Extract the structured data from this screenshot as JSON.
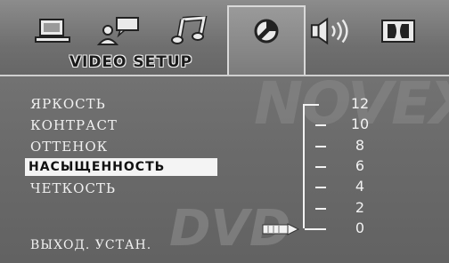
{
  "window_title": "VIDEO SETUP",
  "tabs": [
    {
      "icon": "monitor-icon"
    },
    {
      "icon": "user-speech-icon"
    },
    {
      "icon": "music-note-icon"
    },
    {
      "icon": "video-circle-icon",
      "active": true
    },
    {
      "icon": "speaker-icon"
    },
    {
      "icon": "dolby-icon"
    }
  ],
  "menu": {
    "items": [
      {
        "label": "ЯРКОСТЬ"
      },
      {
        "label": "КОНТРАСТ"
      },
      {
        "label": "ОТТЕНОК"
      },
      {
        "label": "НАСЫЩЕННОСТЬ",
        "selected": true
      },
      {
        "label": "ЧЕТКОСТЬ"
      }
    ],
    "footer": "ВЫХОД. УСТАН."
  },
  "scale": {
    "values": [
      "12",
      "10",
      "8",
      "6",
      "4",
      "2",
      "0"
    ],
    "current_value": "0"
  },
  "watermark": {
    "brand": "NOVEX",
    "logo": "DVD"
  },
  "colors": {
    "highlight": "#f4f4f4",
    "text": "#f0f0f0",
    "background": "#6f6f6f"
  }
}
